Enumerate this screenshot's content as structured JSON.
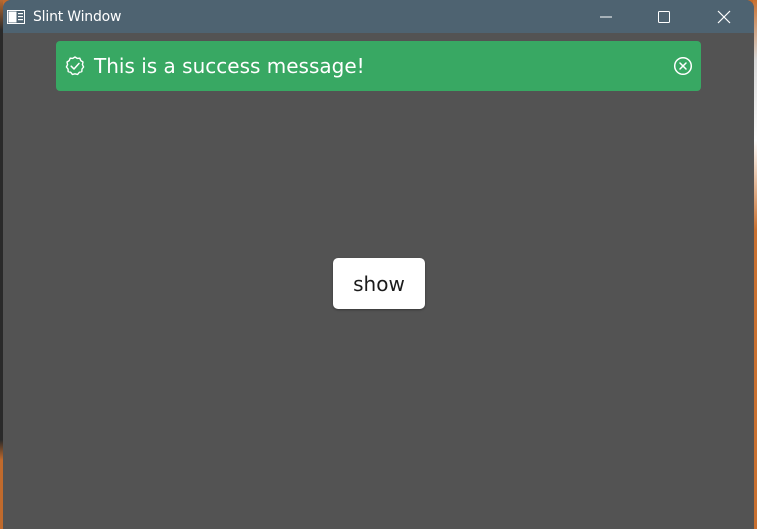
{
  "window": {
    "title": "Slint Window"
  },
  "titlebar": {
    "icons": {
      "app": "app-window-icon",
      "minimize": "minimize-icon",
      "maximize": "maximize-icon",
      "close": "close-icon"
    }
  },
  "toast": {
    "message": "This is a success message!",
    "status_icon": "check-circle-icon",
    "dismiss_icon": "close-circle-icon",
    "color": "#38a863"
  },
  "main": {
    "show_label": "show"
  },
  "colors": {
    "titlebar": "#4e6371",
    "content_background": "#535353",
    "button_background": "#ffffff"
  }
}
